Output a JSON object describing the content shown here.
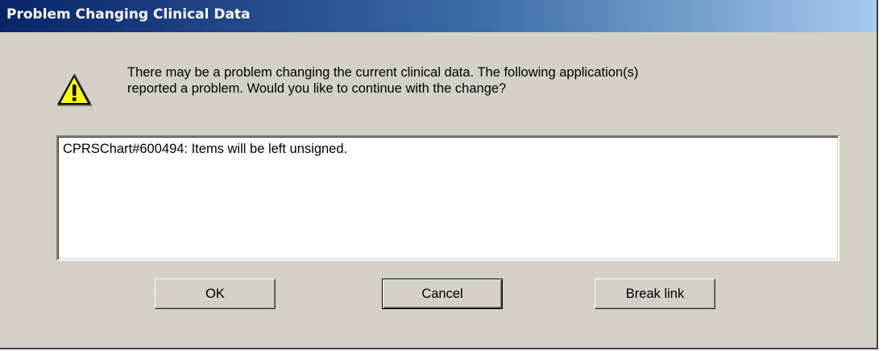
{
  "dialog": {
    "title": "Problem Changing Clinical Data",
    "icon": "warning-icon",
    "message_lines": [
      "There may be a problem changing the current clinical data.  The following application(s)",
      "reported a problem.  Would you like to continue with the change?"
    ],
    "problems": [
      "CPRSChart#600494: Items will be left unsigned."
    ],
    "buttons": {
      "ok_label": "OK",
      "cancel_label": "Cancel",
      "break_link_label": "Break link"
    }
  },
  "colors": {
    "titlebar_start": "#0a246a",
    "titlebar_end": "#a6caf0",
    "dialog_face": "#d4d0c8",
    "warning_yellow": "#ffff00"
  }
}
